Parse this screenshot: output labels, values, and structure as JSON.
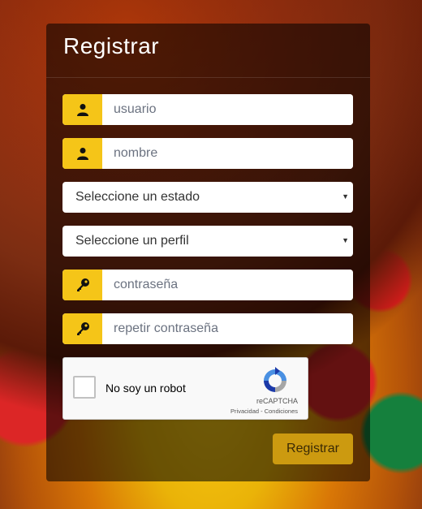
{
  "form": {
    "title": "Registrar",
    "fields": {
      "usuario": {
        "placeholder": "usuario",
        "icon": "user-icon"
      },
      "nombre": {
        "placeholder": "nombre",
        "icon": "user-icon"
      },
      "estado": {
        "selected": "Seleccione un estado"
      },
      "perfil": {
        "selected": "Seleccione un perfil"
      },
      "contrasena": {
        "placeholder": "contraseña",
        "icon": "key-icon"
      },
      "repetir": {
        "placeholder": "repetir contraseña",
        "icon": "key-icon"
      }
    },
    "captcha": {
      "label": "No soy un robot",
      "brand": "reCAPTCHA",
      "links": "Privacidad - Condiciones"
    },
    "submit_label": "Registrar"
  },
  "colors": {
    "addon": "#f5c518",
    "submit": "#cc9a10"
  }
}
